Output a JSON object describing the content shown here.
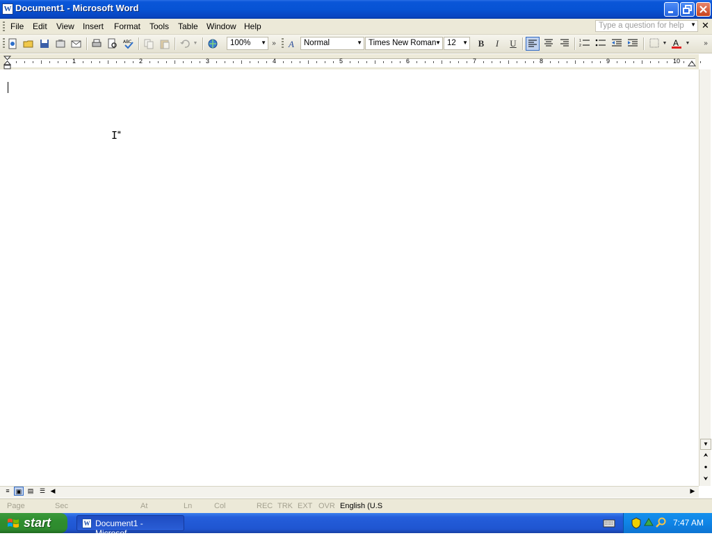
{
  "window": {
    "title": "Document1 - Microsoft Word",
    "app_icon": "W"
  },
  "menubar": {
    "items": [
      "File",
      "Edit",
      "View",
      "Insert",
      "Format",
      "Tools",
      "Table",
      "Window",
      "Help"
    ],
    "help_placeholder": "Type a question for help"
  },
  "toolbar": {
    "zoom": "100%",
    "style": "Normal",
    "font": "Times New Roman",
    "size": "12",
    "bold": "B",
    "italic": "I",
    "underline": "U",
    "font_color": "#e02020"
  },
  "ruler": {
    "numbers": [
      "1",
      "2",
      "3",
      "4",
      "5",
      "6",
      "7",
      "8",
      "9",
      "10"
    ]
  },
  "statusbar": {
    "page": "Page",
    "sec": "Sec",
    "at": "At",
    "ln": "Ln",
    "col": "Col",
    "rec": "REC",
    "trk": "TRK",
    "ext": "EXT",
    "ovr": "OVR",
    "language": "English (U.S"
  },
  "taskbar": {
    "start": "start",
    "task_label": "Document1 - Microsof...",
    "time": "7:47 AM"
  }
}
